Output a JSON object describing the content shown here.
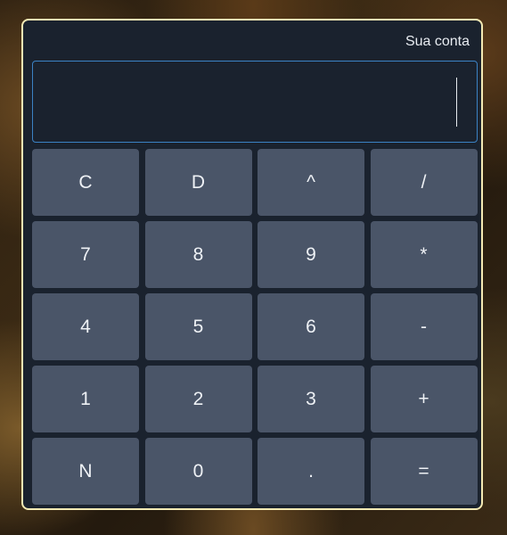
{
  "window": {
    "title": "Sua conta"
  },
  "display": {
    "value": ""
  },
  "keys": [
    {
      "label": "C",
      "name": "clear-button"
    },
    {
      "label": "D",
      "name": "delete-button"
    },
    {
      "label": "^",
      "name": "power-button"
    },
    {
      "label": "/",
      "name": "divide-button"
    },
    {
      "label": "7",
      "name": "digit-7-button"
    },
    {
      "label": "8",
      "name": "digit-8-button"
    },
    {
      "label": "9",
      "name": "digit-9-button"
    },
    {
      "label": "*",
      "name": "multiply-button"
    },
    {
      "label": "4",
      "name": "digit-4-button"
    },
    {
      "label": "5",
      "name": "digit-5-button"
    },
    {
      "label": "6",
      "name": "digit-6-button"
    },
    {
      "label": "-",
      "name": "subtract-button"
    },
    {
      "label": "1",
      "name": "digit-1-button"
    },
    {
      "label": "2",
      "name": "digit-2-button"
    },
    {
      "label": "3",
      "name": "digit-3-button"
    },
    {
      "label": "+",
      "name": "add-button"
    },
    {
      "label": "N",
      "name": "negate-button"
    },
    {
      "label": "0",
      "name": "digit-0-button"
    },
    {
      "label": ".",
      "name": "decimal-point-button"
    },
    {
      "label": "=",
      "name": "equals-button"
    }
  ],
  "colors": {
    "panel": "#1a222e",
    "panel_border": "#f4eab4",
    "display_border": "#3b82c4",
    "key_background": "#4a5568",
    "text": "#e8ecf1"
  }
}
